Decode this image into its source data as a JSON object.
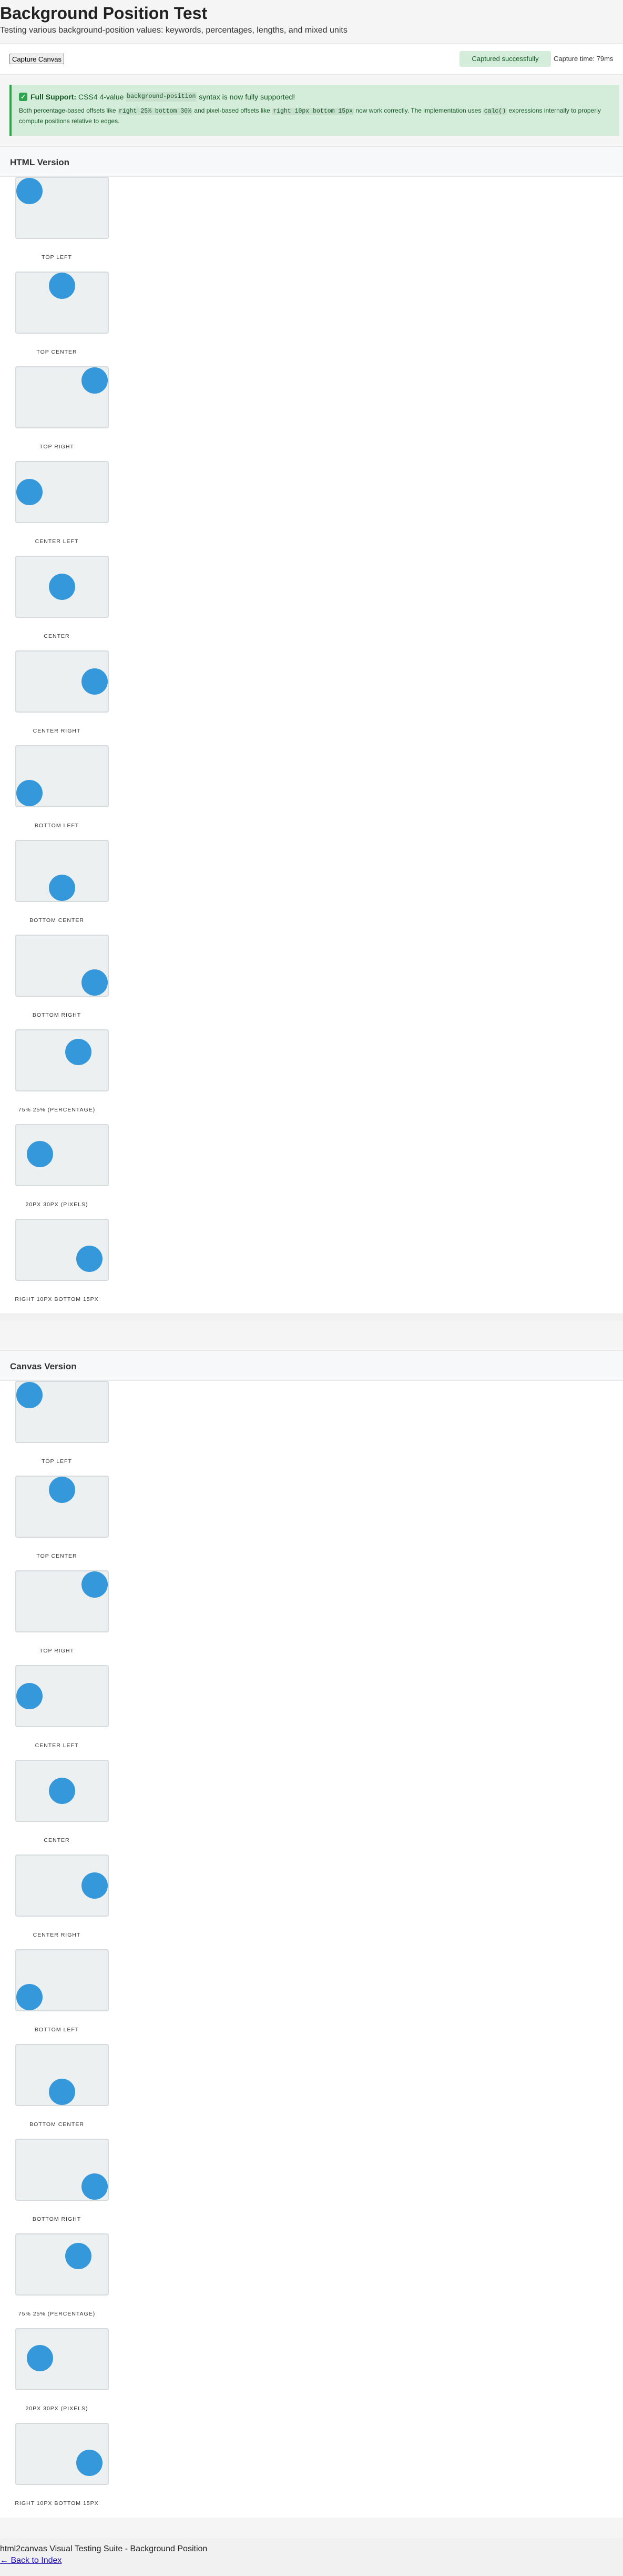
{
  "page": {
    "title": "Background Position Test",
    "subtitle": "Testing various background-position values: keywords, percentages, lengths, and mixed units"
  },
  "toolbar": {
    "capture_label": "Capture Canvas",
    "status": "Captured successfully",
    "capture_time": "Capture time: 79ms"
  },
  "notice": {
    "check_icon": "check-icon",
    "bold": "Full Support:",
    "line1_pre": "CSS4 4-value",
    "line1_code": "background-position",
    "line1_post": "syntax is now fully supported!",
    "line2_a": "Both percentage-based offsets like",
    "line2_code1": "right 25% bottom 30%",
    "line2_b": "and pixel-based offsets like",
    "line2_code2": "right 10px bottom 15px",
    "line2_c": "now work correctly. The implementation uses",
    "line2_code3": "calc()",
    "line2_d": "expressions internally to properly compute positions relative to edges."
  },
  "sections": [
    {
      "title": "HTML Version",
      "items": [
        {
          "label": "top left",
          "pos": "top left"
        },
        {
          "label": "top center",
          "pos": "top center"
        },
        {
          "label": "top right",
          "pos": "top right"
        },
        {
          "label": "center left",
          "pos": "center left"
        },
        {
          "label": "center",
          "pos": "center"
        },
        {
          "label": "center right",
          "pos": "center right"
        },
        {
          "label": "bottom left",
          "pos": "bottom left"
        },
        {
          "label": "bottom center",
          "pos": "bottom center"
        },
        {
          "label": "bottom right",
          "pos": "bottom right"
        },
        {
          "label": "75% 25% (percentage)",
          "pos": "75% 25%"
        },
        {
          "label": "20px 30px (pixels)",
          "pos": "20px 30px"
        },
        {
          "label": "right 10px bottom 15px",
          "pos": "right 10px bottom 15px"
        }
      ]
    },
    {
      "title": "Canvas Version",
      "items": [
        {
          "label": "top left",
          "pos": "top left"
        },
        {
          "label": "top center",
          "pos": "top center"
        },
        {
          "label": "top right",
          "pos": "top right"
        },
        {
          "label": "center left",
          "pos": "center left"
        },
        {
          "label": "center",
          "pos": "center"
        },
        {
          "label": "center right",
          "pos": "center right"
        },
        {
          "label": "bottom left",
          "pos": "bottom left"
        },
        {
          "label": "bottom center",
          "pos": "bottom center"
        },
        {
          "label": "bottom right",
          "pos": "bottom right"
        },
        {
          "label": "75% 25% (percentage)",
          "pos": "75% 25%"
        },
        {
          "label": "20px 30px (pixels)",
          "pos": "20px 30px"
        },
        {
          "label": "right 10px bottom 15px",
          "pos": "right 10px bottom 15px"
        }
      ]
    }
  ],
  "footer": {
    "text": "html2canvas Visual Testing Suite - Background Position",
    "back_link": "← Back to Index"
  },
  "colors": {
    "circle": "#3498db",
    "box_bg": "#ecf0f1",
    "notice_bg": "#d4edda",
    "notice_border": "#28a745"
  }
}
